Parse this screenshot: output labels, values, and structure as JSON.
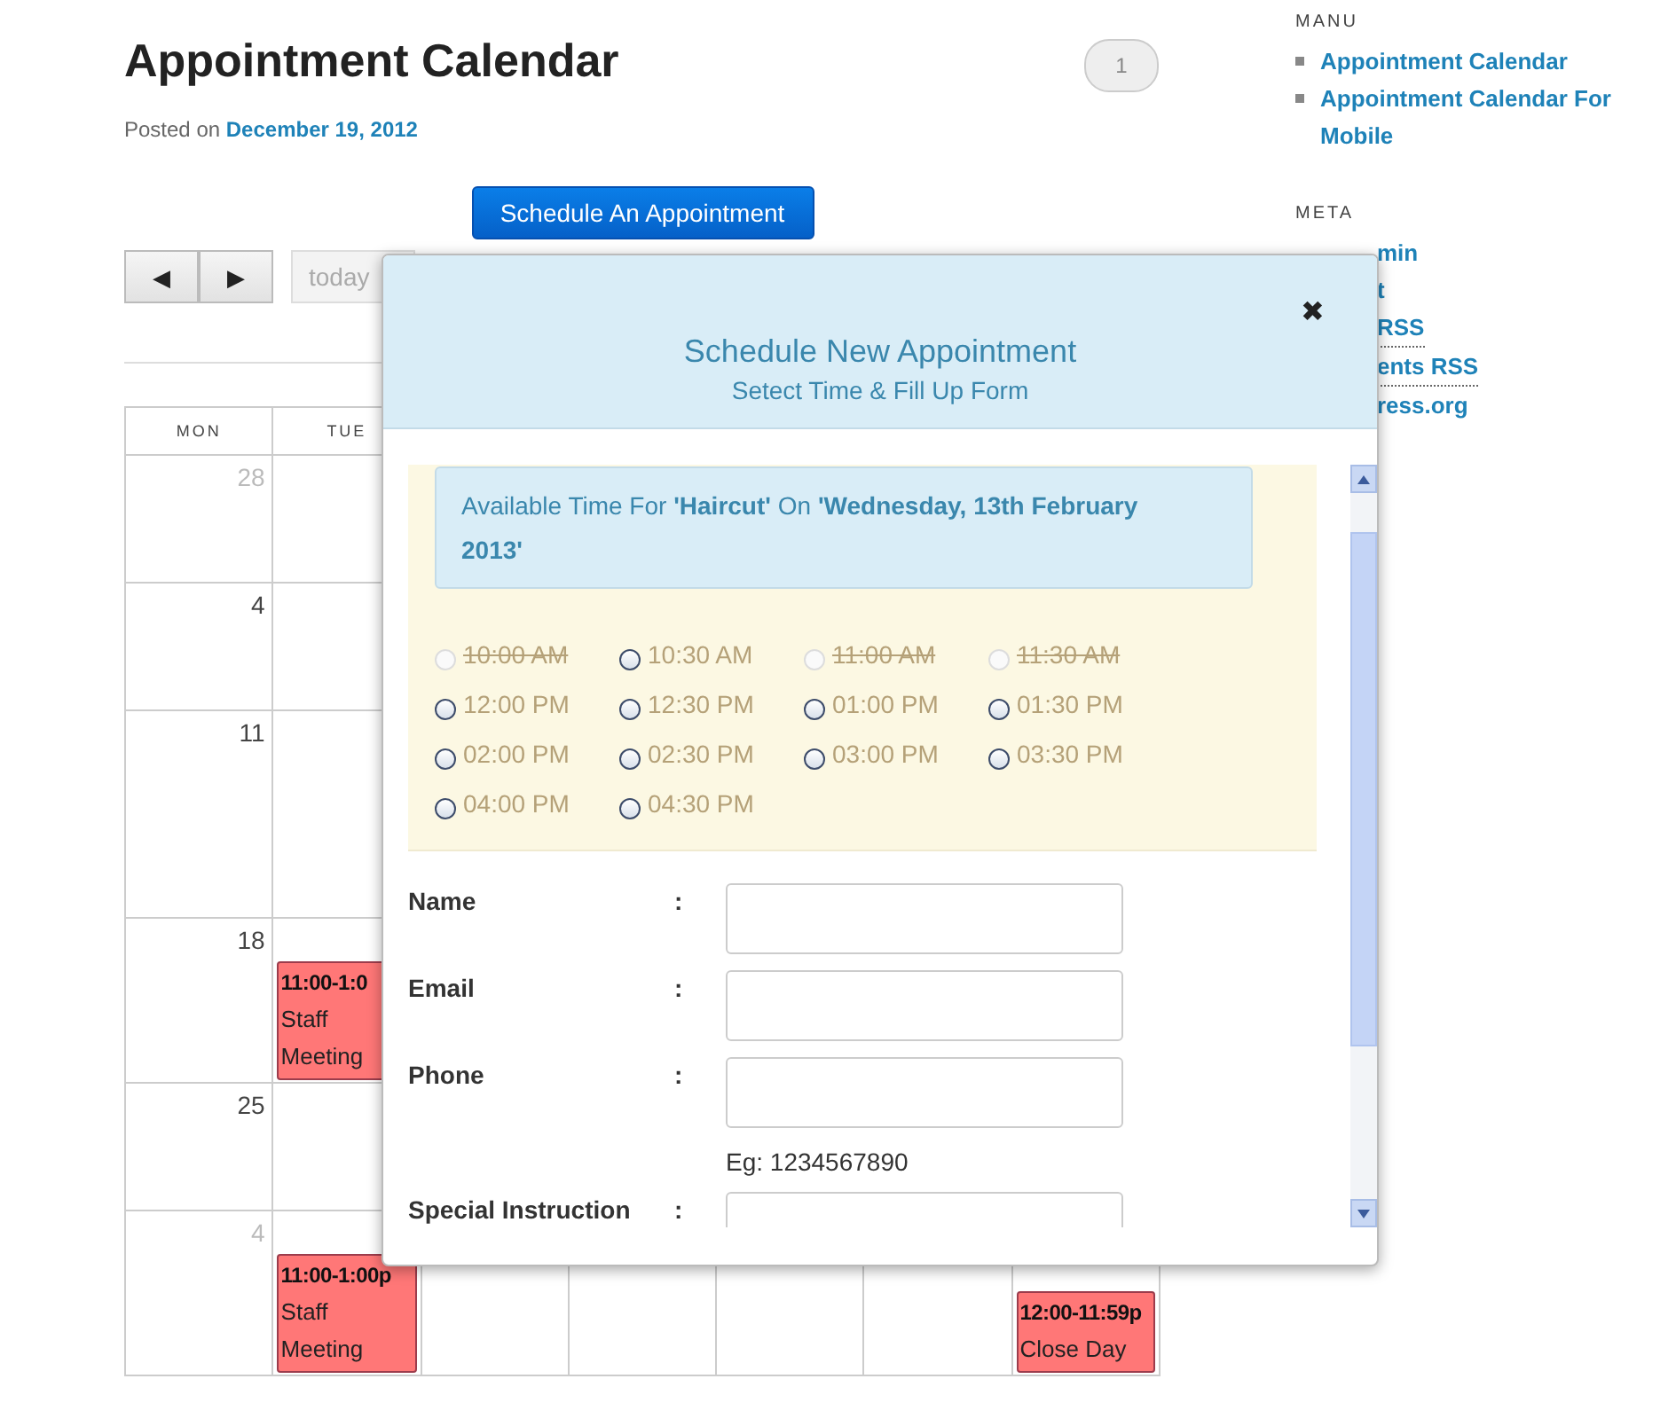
{
  "post": {
    "title": "Appointment Calendar",
    "posted_label": "Posted on",
    "posted_date": "December 19, 2012",
    "comment_count": "1",
    "schedule_button": "Schedule An Appointment"
  },
  "calendar": {
    "prev": "◀",
    "next": "▶",
    "today": "today",
    "headers": [
      "MON",
      "TUE"
    ],
    "weeks": [
      {
        "day": "28",
        "other_month": true
      },
      {
        "day": "4",
        "other_month": false
      },
      {
        "day": "11",
        "other_month": false
      },
      {
        "day": "18",
        "other_month": false,
        "tuesday": [
          {
            "time": "11:00-1:0",
            "title": "Staff Meeting"
          }
        ]
      },
      {
        "day": "25",
        "other_month": false
      },
      {
        "day": "4",
        "other_month": true,
        "tuesday": [
          {
            "time": "11:00-1:00p",
            "title": "Staff Meeting"
          }
        ],
        "sunday": [
          {
            "time": "12:00-11:59p",
            "title": "Close Day"
          }
        ]
      }
    ]
  },
  "sidebar": {
    "sections": [
      {
        "heading": "MANU",
        "kind": "bulleted",
        "links": [
          "Appointment Calendar",
          "Appointment Calendar For Mobile"
        ]
      },
      {
        "heading": "META",
        "kind": "covered",
        "links": [
          {
            "text": "min",
            "abbr": false
          },
          {
            "text": "t",
            "abbr": false
          },
          {
            "text": "RSS",
            "abbr": true
          },
          {
            "text": "ents RSS",
            "abbr": true
          },
          {
            "text": "ress.org",
            "abbr": false
          }
        ]
      }
    ]
  },
  "modal": {
    "title": "Schedule New Appointment",
    "subtitle": "Setect Time & Fill Up Form",
    "close": "✖",
    "info": "Available Time For **'Haircut'** On **'Wednesday, 13th February 2013'**",
    "slots": [
      {
        "label": "10:00 AM",
        "disabled": true,
        "selected": false
      },
      {
        "label": "10:30 AM",
        "disabled": false,
        "selected": false
      },
      {
        "label": "11:00 AM",
        "disabled": true,
        "selected": false
      },
      {
        "label": "11:30 AM",
        "disabled": true,
        "selected": false
      },
      {
        "label": "12:00 PM",
        "disabled": false,
        "selected": false
      },
      {
        "label": "12:30 PM",
        "disabled": false,
        "selected": false
      },
      {
        "label": "01:00 PM",
        "disabled": false,
        "selected": false
      },
      {
        "label": "01:30 PM",
        "disabled": false,
        "selected": false
      },
      {
        "label": "02:00 PM",
        "disabled": false,
        "selected": false
      },
      {
        "label": "02:30 PM",
        "disabled": false,
        "selected": false
      },
      {
        "label": "03:00 PM",
        "disabled": false,
        "selected": false
      },
      {
        "label": "03:30 PM",
        "disabled": false,
        "selected": false
      },
      {
        "label": "04:00 PM",
        "disabled": false,
        "selected": false
      },
      {
        "label": "04:30 PM",
        "disabled": false,
        "selected": false
      }
    ],
    "fields": [
      {
        "label": "Name",
        "colon": ":"
      },
      {
        "label": "Email",
        "colon": ":"
      },
      {
        "label": "Phone",
        "colon": ":",
        "hint": "Eg: 1234567890"
      },
      {
        "label": "Special Instruction",
        "colon": ":"
      }
    ]
  }
}
